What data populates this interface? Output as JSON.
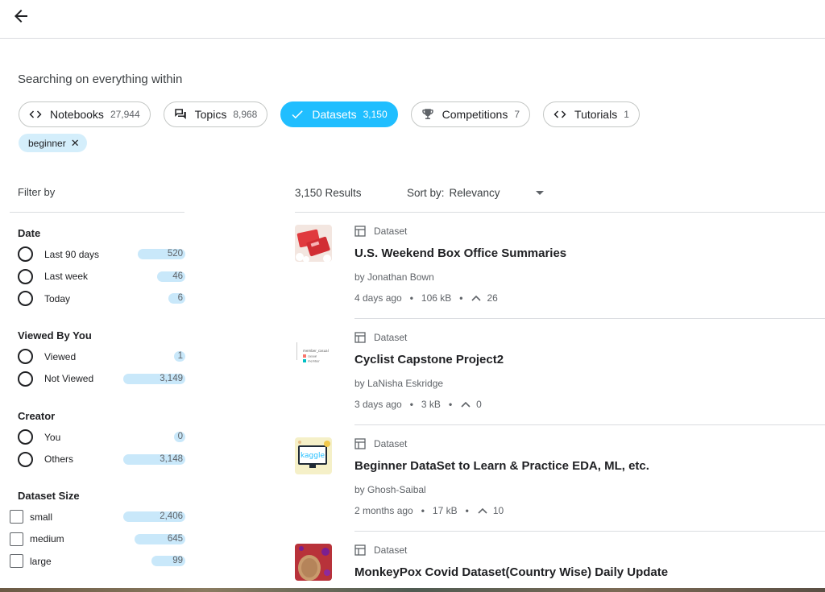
{
  "search": {
    "label": "Searching on everything within"
  },
  "chips": [
    {
      "id": "notebooks",
      "label": "Notebooks",
      "count": "27,944",
      "icon": "code-icon",
      "active": false
    },
    {
      "id": "topics",
      "label": "Topics",
      "count": "8,968",
      "icon": "forum-icon",
      "active": false
    },
    {
      "id": "datasets",
      "label": "Datasets",
      "count": "3,150",
      "icon": "check-icon",
      "active": true
    },
    {
      "id": "competitions",
      "label": "Competitions",
      "count": "7",
      "icon": "trophy-icon",
      "active": false
    },
    {
      "id": "tutorials",
      "label": "Tutorials",
      "count": "1",
      "icon": "code-icon",
      "active": false
    }
  ],
  "tag": {
    "label": "beginner"
  },
  "filters": {
    "title": "Filter by",
    "date": {
      "heading": "Date",
      "options": [
        {
          "label": "Last 90 days",
          "count": "520",
          "fill": 0.42
        },
        {
          "label": "Last week",
          "count": "46",
          "fill": 0.25
        },
        {
          "label": "Today",
          "count": "6",
          "fill": 0.15
        }
      ]
    },
    "viewed": {
      "heading": "Viewed By You",
      "options": [
        {
          "label": "Viewed",
          "count": "1",
          "fill": 0.1
        },
        {
          "label": "Not Viewed",
          "count": "3,149",
          "fill": 0.55
        }
      ]
    },
    "creator": {
      "heading": "Creator",
      "options": [
        {
          "label": "You",
          "count": "0",
          "fill": 0.1
        },
        {
          "label": "Others",
          "count": "3,148",
          "fill": 0.55
        }
      ]
    },
    "size": {
      "heading": "Dataset Size",
      "options": [
        {
          "label": "small",
          "count": "2,406",
          "fill": 0.55
        },
        {
          "label": "medium",
          "count": "645",
          "fill": 0.45
        },
        {
          "label": "large",
          "count": "99",
          "fill": 0.3
        }
      ]
    }
  },
  "results": {
    "count_label": "3,150 Results",
    "sort_label": "Sort by:",
    "sort_value": "Relevancy",
    "items": [
      {
        "type": "Dataset",
        "title": "U.S. Weekend Box Office Summaries",
        "author": "by Jonathan Bown",
        "age": "4 days ago",
        "size": "106 kB",
        "votes": "26",
        "thumb": "tickets"
      },
      {
        "type": "Dataset",
        "title": "Cyclist Capstone Project2",
        "author": "by LaNisha Eskridge",
        "age": "3 days ago",
        "size": "3 kB",
        "votes": "0",
        "thumb": "legend",
        "thumb_lines": [
          "member_casual",
          "casual",
          "member"
        ]
      },
      {
        "type": "Dataset",
        "title": "Beginner DataSet to Learn & Practice EDA, ML, etc.",
        "author": "by Ghosh-Saibal",
        "age": "2 months ago",
        "size": "17 kB",
        "votes": "10",
        "thumb": "kaggle",
        "thumb_text": "kaggle"
      },
      {
        "type": "Dataset",
        "title": "MonkeyPox Covid Dataset(Country Wise) Daily Update",
        "author": "",
        "age": "",
        "size": "",
        "votes": "",
        "thumb": "virus"
      }
    ]
  },
  "colors": {
    "accent": "#20beff",
    "count_pill": "#c9e8fa",
    "tag": "#d4eefb"
  }
}
